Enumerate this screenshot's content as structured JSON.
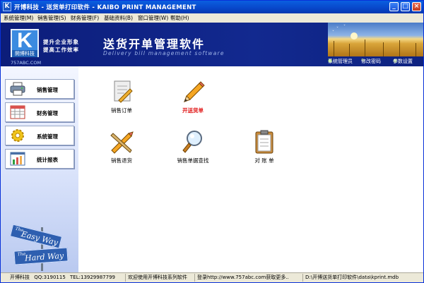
{
  "window": {
    "icon_letter": "K",
    "title": "开博科技 - 送货单打印软件 - KAIBO PRINT MANAGEMENT",
    "minimize": "_",
    "maximize": "□",
    "close": "×"
  },
  "menu": [
    "系统管理(M)",
    "销售管理(S)",
    "财务管理(F)",
    "基础资料(B)",
    "窗口管理(W)",
    "帮助(H)"
  ],
  "banner": {
    "logo_letter": "K",
    "logo_brand": "開博科技",
    "logo_url": "757ABC.COM",
    "slogan_line1": "提升企业形象",
    "slogan_line2": "提高工作效率",
    "title": "送货开单管理软件",
    "subtitle": "Delivery bill management software",
    "links": [
      {
        "label": "系统管理员",
        "icon": "user-icon"
      },
      {
        "label": "修改密码",
        "icon": "key-icon"
      },
      {
        "label": "参数设置",
        "icon": "settings-icon"
      }
    ]
  },
  "sidebar": {
    "items": [
      {
        "label": "销售管理",
        "icon": "printer-icon"
      },
      {
        "label": "财务管理",
        "icon": "calendar-icon"
      },
      {
        "label": "系统管理",
        "icon": "gear-icon"
      },
      {
        "label": "统计报表",
        "icon": "chart-icon"
      }
    ],
    "sign_top": "Easy Way",
    "sign_top_prefix": "The",
    "sign_bottom": "Hard Way",
    "sign_bottom_prefix": "The"
  },
  "tiles": [
    {
      "label": "销售订单",
      "icon": "order-document-icon",
      "highlight": false
    },
    {
      "label": "开送货单",
      "icon": "pencil-icon",
      "highlight": true
    },
    {
      "label": "销售退货",
      "icon": "tools-cross-icon",
      "highlight": false
    },
    {
      "label": "销售单据查找",
      "icon": "magnifier-icon",
      "highlight": false
    },
    {
      "label": "对 账 单",
      "icon": "clipboard-icon",
      "highlight": false
    }
  ],
  "status": {
    "company": "开博科技",
    "qq": "QQ:3190115",
    "tel": "TEL:13929987799",
    "welcome": "欢迎使用开博科技系列软件",
    "login_hint": "登录http://www.757abc.com获取更多..",
    "path": "D:\\开博送货单打印软件\\data\\kprint.mdb"
  },
  "colors": {
    "banner": "#12298f",
    "titlebar": "#0846c9",
    "highlight_text": "#e01010"
  }
}
